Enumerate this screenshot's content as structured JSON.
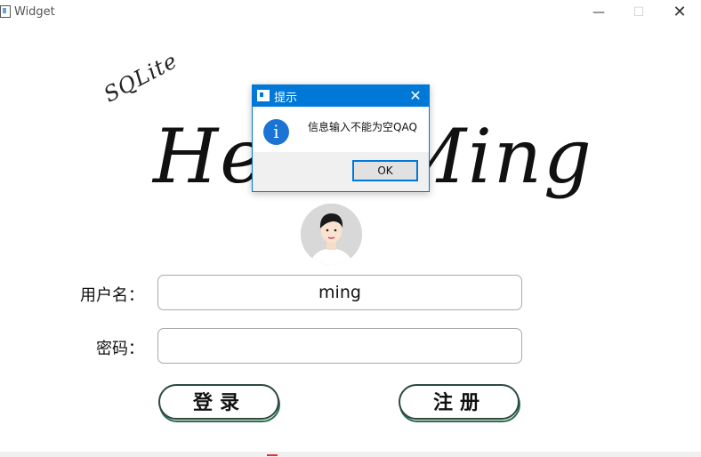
{
  "window": {
    "title": "Widget"
  },
  "logo": {
    "sqlite": "SQLite",
    "headline": "Hello Ming"
  },
  "form": {
    "username_label": "用户名：",
    "username_value": "ming",
    "password_label": "密码：",
    "password_value": ""
  },
  "buttons": {
    "login": "登录",
    "register": "注册"
  },
  "dialog": {
    "title": "提示",
    "message": "信息输入不能为空QAQ",
    "ok": "OK"
  },
  "colors": {
    "dialog_accent": "#0078d7",
    "info_icon": "#1b74d3",
    "button_outline": "#4b8a6c"
  }
}
